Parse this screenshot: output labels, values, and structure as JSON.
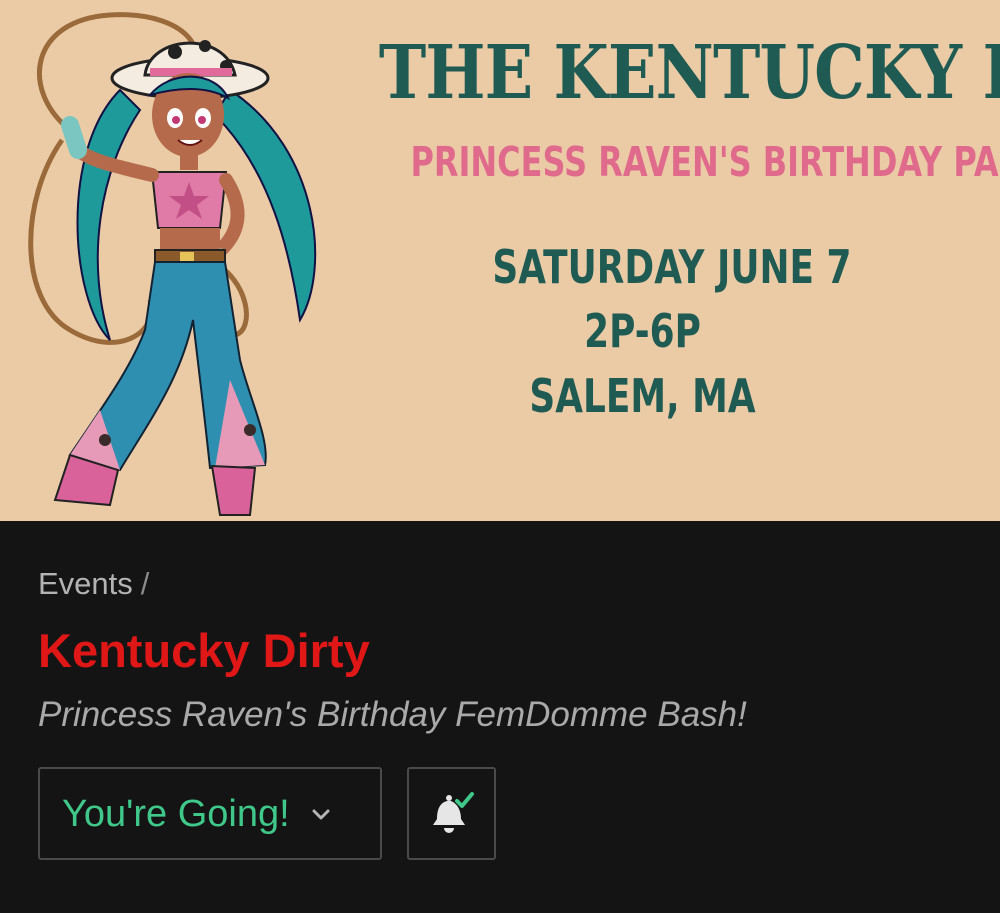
{
  "banner": {
    "title": "THE KENTUCKY DIRTY",
    "subtitle": "PRINCESS RAVEN'S BIRTHDAY PARTY",
    "date": "SATURDAY JUNE 7",
    "time": "2P-6P",
    "location": "SALEM, MA"
  },
  "breadcrumb": {
    "section": "Events",
    "separator": "/"
  },
  "event": {
    "title": "Kentucky Dirty",
    "subtitle": "Princess Raven's Birthday FemDomme Bash!"
  },
  "actions": {
    "rsvp_label": "You're Going!",
    "rsvp_icon": "chevron-down-icon",
    "notify_icon": "bell-check-icon"
  },
  "colors": {
    "banner_bg": "#ebcba6",
    "banner_title": "#1f5b53",
    "banner_subtitle": "#df6a8c",
    "page_bg": "#141414",
    "event_title": "#e01717",
    "rsvp_text": "#3fc88a"
  }
}
